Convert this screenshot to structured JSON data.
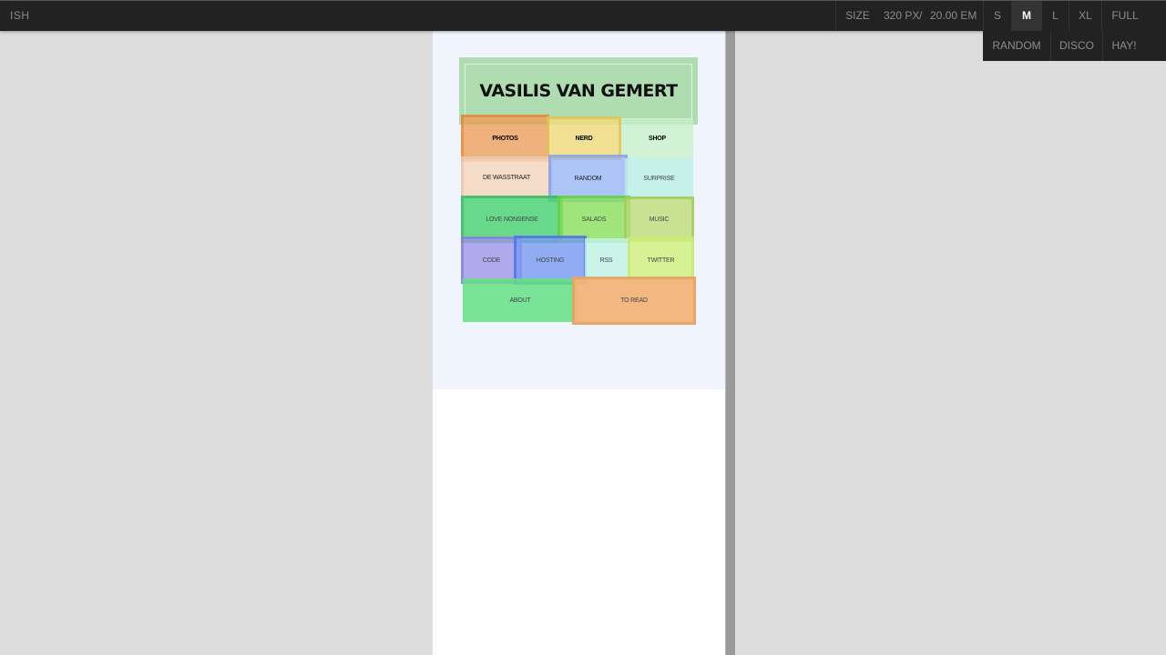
{
  "toolbar": {
    "brand": "ISH",
    "size_label": "SIZE",
    "size_px": "320 PX",
    "size_sep": "/",
    "size_em": "20.00 EM",
    "sizes": [
      {
        "label": "S"
      },
      {
        "label": "M",
        "active": true
      },
      {
        "label": "L"
      },
      {
        "label": "XL"
      },
      {
        "label": "FULL"
      }
    ],
    "modes": [
      {
        "label": "RANDOM"
      },
      {
        "label": "DISCO"
      },
      {
        "label": "HAY!"
      }
    ]
  },
  "site": {
    "title": "VASILIS VAN GEMERT",
    "tiles": [
      {
        "label": "PHOTOS",
        "color": "#f0a86a"
      },
      {
        "label": "NERD",
        "color": "#f2e08a"
      },
      {
        "label": "SHOP",
        "color": "#d4f5d4"
      },
      {
        "label": "DE WASSTRAAT",
        "color": "#f5ddc8"
      },
      {
        "label": "RANDOM",
        "color": "#a9c2f5"
      },
      {
        "label": "SURPRISE",
        "color": "#c8f3ec"
      },
      {
        "label": "LOVE NONSENSE",
        "color": "#5fd87f"
      },
      {
        "label": "SALADS",
        "color": "#9ee56a"
      },
      {
        "label": "MUSIC",
        "color": "#c9e392"
      },
      {
        "label": "CODE",
        "color": "#ad9ee6"
      },
      {
        "label": "HOSTING",
        "color": "#7fa0ee"
      },
      {
        "label": "RSS",
        "color": "#c8f3ea"
      },
      {
        "label": "TWITTER",
        "color": "#d5f08a"
      },
      {
        "label": "ABOUT",
        "color": "#6ee68a"
      },
      {
        "label": "TO READ",
        "color": "#f2b47a"
      }
    ]
  }
}
